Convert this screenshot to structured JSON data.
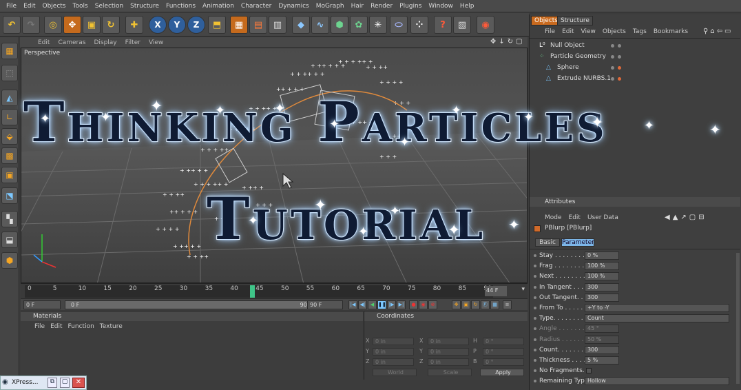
{
  "menubar": [
    "File",
    "Edit",
    "Objects",
    "Tools",
    "Selection",
    "Structure",
    "Functions",
    "Animation",
    "Character",
    "Dynamics",
    "MoGraph",
    "Hair",
    "Render",
    "Plugins",
    "Window",
    "Help"
  ],
  "toolbar": {
    "x": "X",
    "y": "Y",
    "z": "Z"
  },
  "viewport": {
    "menu": [
      "Edit",
      "Cameras",
      "Display",
      "Filter",
      "View"
    ],
    "label": "Perspective"
  },
  "overlay": {
    "line1": "Thinking Particles",
    "line2": "Tutorial"
  },
  "timeline": {
    "ticks": [
      "0",
      "5",
      "10",
      "15",
      "20",
      "25",
      "30",
      "35",
      "40",
      "45",
      "50",
      "55",
      "60",
      "65",
      "70",
      "75",
      "80",
      "85",
      "90"
    ],
    "current_frame": "44 F"
  },
  "transport": {
    "start": "0 F",
    "range_start": "0 F",
    "range_end": "90 F",
    "end": "90 F"
  },
  "materials": {
    "title": "Materials",
    "menu": [
      "File",
      "Edit",
      "Function",
      "Texture"
    ]
  },
  "coordinates": {
    "title": "Coordinates",
    "rows": [
      {
        "a": "X",
        "av": "0 in",
        "b": "X",
        "bv": "0 in",
        "c": "H",
        "cv": "0 °"
      },
      {
        "a": "Y",
        "av": "0 in",
        "b": "Y",
        "bv": "0 in",
        "c": "P",
        "cv": "0 °"
      },
      {
        "a": "Z",
        "av": "0 in",
        "b": "Z",
        "bv": "0 in",
        "c": "B",
        "cv": "0 °"
      }
    ],
    "mode1": "World",
    "mode2": "Scale",
    "apply": "Apply"
  },
  "objects_panel": {
    "tabs": [
      "Objects",
      "Structure"
    ],
    "menu": [
      "File",
      "Edit",
      "View",
      "Objects",
      "Tags",
      "Bookmarks"
    ],
    "items": [
      {
        "name": "Null Object",
        "indent": 0
      },
      {
        "name": "Particle Geometry",
        "indent": 0
      },
      {
        "name": "Sphere",
        "indent": 1
      },
      {
        "name": "Extrude NURBS.1",
        "indent": 1
      }
    ]
  },
  "attributes": {
    "title": "Attributes",
    "menu": [
      "Mode",
      "Edit",
      "User Data"
    ],
    "object": "PBlurp [PBlurp]",
    "tabs": [
      "Basic",
      "Parameter"
    ],
    "params": [
      {
        "label": "Stay . . . . . . . . .",
        "value": "0 %",
        "dim": false
      },
      {
        "label": "Frag . . . . . . . . .",
        "value": "100 %",
        "dim": false
      },
      {
        "label": "Next . . . . . . . . .",
        "value": "100 %",
        "dim": false
      },
      {
        "label": "In Tangent . . . .",
        "value": "300",
        "dim": false
      },
      {
        "label": "Out Tangent. . . .",
        "value": "300",
        "dim": false
      },
      {
        "label": "From To . . . . . .",
        "value": "+Y to -Y",
        "dim": false,
        "dropdown": true
      },
      {
        "label": "Type. . . . . . . . .",
        "value": "Count",
        "dim": false,
        "dropdown": true
      },
      {
        "label": "Angle . . . . . . . .",
        "value": "45 °",
        "dim": true
      },
      {
        "label": "Radius . . . . . . .",
        "value": "50 %",
        "dim": true
      },
      {
        "label": "Count. . . . . . . . .",
        "value": "300",
        "dim": false
      },
      {
        "label": "Thickness . . . . .",
        "value": "5 %",
        "dim": false
      },
      {
        "label": "No Fragments. . .",
        "value": "",
        "dim": false,
        "checkbox": true
      },
      {
        "label": "Remaining Type",
        "value": "Hollow",
        "dim": false,
        "dropdown": true
      }
    ]
  },
  "taskbar": {
    "label": "XPress..."
  }
}
